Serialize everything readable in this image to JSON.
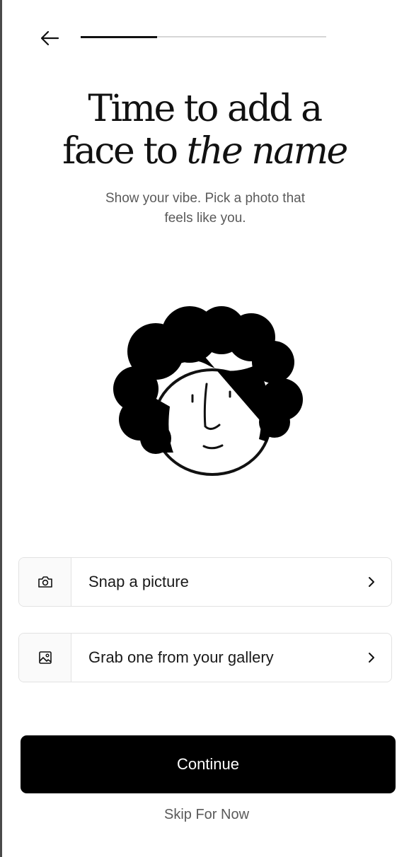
{
  "header": {
    "back_icon": "arrow-left-icon",
    "progress": 0.31
  },
  "headline": {
    "line1": "Time to add a",
    "line2_regular": "face to ",
    "line2_italic": "the name"
  },
  "subtitle": {
    "line1": "Show your vibe. Pick a photo that",
    "line2": "feels like you."
  },
  "illustration": {
    "icon": "curly-hair-avatar-illustration"
  },
  "options": [
    {
      "label": "Snap a picture",
      "icon": "camera-icon",
      "chevron_icon": "chevron-right-icon"
    },
    {
      "label": "Grab one from your gallery",
      "icon": "image-gallery-icon",
      "chevron_icon": "chevron-right-icon"
    }
  ],
  "actions": {
    "continue_label": "Continue",
    "skip_label": "Skip For Now"
  },
  "colors": {
    "primary": "#000000",
    "text": "#111111",
    "muted_text": "#5a5a5a",
    "border": "#e2e2e2",
    "progress_track": "#d6d6d6"
  }
}
